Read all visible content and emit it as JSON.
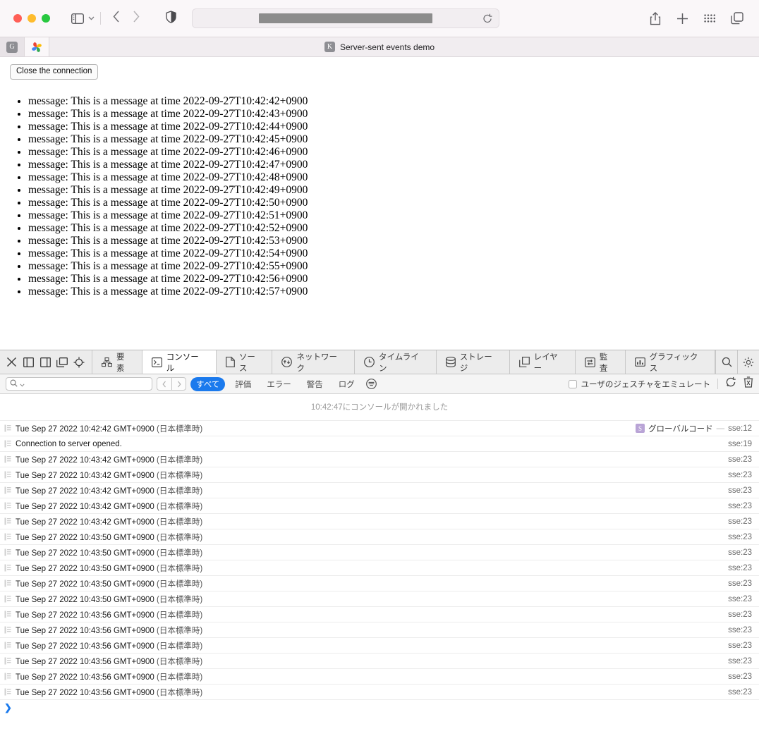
{
  "browser": {
    "window_controls": [
      "close",
      "minimize",
      "zoom"
    ],
    "sidebar_icon": "sidebar-icon",
    "dropdown_icon": "chevron-down-icon",
    "back_icon": "back-chevron-icon",
    "forward_icon": "forward-chevron-icon",
    "shield_icon": "privacy-shield-icon",
    "address_value": "",
    "address_placeholder": "",
    "reload_icon": "reload-icon",
    "share_icon": "share-icon",
    "new_tab_icon": "plus-icon",
    "apps_icon": "grid-apps-icon",
    "tab_overview_icon": "tab-overview-icon"
  },
  "tabs": {
    "items": [
      {
        "favicon_letter": "G",
        "name": "google-tab"
      },
      {
        "favicon_letter": "",
        "name": "photos-tab"
      }
    ],
    "active_title": "Server-sent events demo",
    "active_favicon_letter": "K"
  },
  "page": {
    "close_button_label": "Close the connection",
    "messages": [
      "message: This is a message at time 2022-09-27T10:42:42+0900",
      "message: This is a message at time 2022-09-27T10:42:43+0900",
      "message: This is a message at time 2022-09-27T10:42:44+0900",
      "message: This is a message at time 2022-09-27T10:42:45+0900",
      "message: This is a message at time 2022-09-27T10:42:46+0900",
      "message: This is a message at time 2022-09-27T10:42:47+0900",
      "message: This is a message at time 2022-09-27T10:42:48+0900",
      "message: This is a message at time 2022-09-27T10:42:49+0900",
      "message: This is a message at time 2022-09-27T10:42:50+0900",
      "message: This is a message at time 2022-09-27T10:42:51+0900",
      "message: This is a message at time 2022-09-27T10:42:52+0900",
      "message: This is a message at time 2022-09-27T10:42:53+0900",
      "message: This is a message at time 2022-09-27T10:42:54+0900",
      "message: This is a message at time 2022-09-27T10:42:55+0900",
      "message: This is a message at time 2022-09-27T10:42:56+0900",
      "message: This is a message at time 2022-09-27T10:42:57+0900"
    ]
  },
  "devtools": {
    "left_icons": [
      {
        "name": "close-devtools-icon"
      },
      {
        "name": "dock-left-icon"
      },
      {
        "name": "dock-right-icon"
      },
      {
        "name": "dock-undock-icon"
      },
      {
        "name": "inspect-element-icon"
      }
    ],
    "tabs": [
      {
        "label": "要素",
        "icon": "elements-icon",
        "selected": false
      },
      {
        "label": "コンソール",
        "icon": "console-icon",
        "selected": true
      },
      {
        "label": "ソース",
        "icon": "sources-icon",
        "selected": false
      },
      {
        "label": "ネットワーク",
        "icon": "network-icon",
        "selected": false
      },
      {
        "label": "タイムライン",
        "icon": "timeline-icon",
        "selected": false
      },
      {
        "label": "ストレージ",
        "icon": "storage-icon",
        "selected": false
      },
      {
        "label": "レイヤー",
        "icon": "layers-icon",
        "selected": false
      },
      {
        "label": "監査",
        "icon": "audit-icon",
        "selected": false
      },
      {
        "label": "グラフィックス",
        "icon": "graphics-icon",
        "selected": false
      }
    ],
    "right_icons": [
      {
        "name": "search-icon"
      },
      {
        "name": "gear-icon"
      }
    ],
    "filter_bar": {
      "search_value": "",
      "search_placeholder": "",
      "search_icon": "search-icon",
      "search_dropdown_icon": "chevron-down-icon",
      "prev_icon": "prev-chevron-icon",
      "next_icon": "next-chevron-icon",
      "pills": [
        {
          "label": "すべて",
          "active": true
        },
        {
          "label": "評価",
          "active": false
        },
        {
          "label": "エラー",
          "active": false
        },
        {
          "label": "警告",
          "active": false
        },
        {
          "label": "ログ",
          "active": false
        }
      ],
      "settings_icon": "filter-settings-icon",
      "emulate_gesture_label": "ユーザのジェスチャをエミュレート",
      "emulate_gesture_checked": false,
      "preserve_log_icon": "preserve-log-icon",
      "clear_console_icon": "trash-icon"
    },
    "console": {
      "opened_notice": "10:42:47にコンソールが開かれました",
      "rows": [
        {
          "icon": "log-icon",
          "message": "Tue Sep 27 2022 10:42:42 GMT+0900 ",
          "tz": "(日本標準時)",
          "badge": "S",
          "fn": "グローバルコード",
          "dash": "—",
          "link": "sse:12"
        },
        {
          "icon": "log-icon",
          "message": "Connection to server opened.",
          "tz": "",
          "badge": "",
          "fn": "",
          "dash": "",
          "link": "sse:19"
        },
        {
          "icon": "log-icon",
          "message": "Tue Sep 27 2022 10:43:42 GMT+0900 ",
          "tz": "(日本標準時)",
          "badge": "",
          "fn": "",
          "dash": "",
          "link": "sse:23"
        },
        {
          "icon": "log-icon",
          "message": "Tue Sep 27 2022 10:43:42 GMT+0900 ",
          "tz": "(日本標準時)",
          "badge": "",
          "fn": "",
          "dash": "",
          "link": "sse:23"
        },
        {
          "icon": "log-icon",
          "message": "Tue Sep 27 2022 10:43:42 GMT+0900 ",
          "tz": "(日本標準時)",
          "badge": "",
          "fn": "",
          "dash": "",
          "link": "sse:23"
        },
        {
          "icon": "log-icon",
          "message": "Tue Sep 27 2022 10:43:42 GMT+0900 ",
          "tz": "(日本標準時)",
          "badge": "",
          "fn": "",
          "dash": "",
          "link": "sse:23"
        },
        {
          "icon": "log-icon",
          "message": "Tue Sep 27 2022 10:43:42 GMT+0900 ",
          "tz": "(日本標準時)",
          "badge": "",
          "fn": "",
          "dash": "",
          "link": "sse:23"
        },
        {
          "icon": "log-icon",
          "message": "Tue Sep 27 2022 10:43:50 GMT+0900 ",
          "tz": "(日本標準時)",
          "badge": "",
          "fn": "",
          "dash": "",
          "link": "sse:23"
        },
        {
          "icon": "log-icon",
          "message": "Tue Sep 27 2022 10:43:50 GMT+0900 ",
          "tz": "(日本標準時)",
          "badge": "",
          "fn": "",
          "dash": "",
          "link": "sse:23"
        },
        {
          "icon": "log-icon",
          "message": "Tue Sep 27 2022 10:43:50 GMT+0900 ",
          "tz": "(日本標準時)",
          "badge": "",
          "fn": "",
          "dash": "",
          "link": "sse:23"
        },
        {
          "icon": "log-icon",
          "message": "Tue Sep 27 2022 10:43:50 GMT+0900 ",
          "tz": "(日本標準時)",
          "badge": "",
          "fn": "",
          "dash": "",
          "link": "sse:23"
        },
        {
          "icon": "log-icon",
          "message": "Tue Sep 27 2022 10:43:50 GMT+0900 ",
          "tz": "(日本標準時)",
          "badge": "",
          "fn": "",
          "dash": "",
          "link": "sse:23"
        },
        {
          "icon": "log-icon",
          "message": "Tue Sep 27 2022 10:43:56 GMT+0900 ",
          "tz": "(日本標準時)",
          "badge": "",
          "fn": "",
          "dash": "",
          "link": "sse:23"
        },
        {
          "icon": "log-icon",
          "message": "Tue Sep 27 2022 10:43:56 GMT+0900 ",
          "tz": "(日本標準時)",
          "badge": "",
          "fn": "",
          "dash": "",
          "link": "sse:23"
        },
        {
          "icon": "log-icon",
          "message": "Tue Sep 27 2022 10:43:56 GMT+0900 ",
          "tz": "(日本標準時)",
          "badge": "",
          "fn": "",
          "dash": "",
          "link": "sse:23"
        },
        {
          "icon": "log-icon",
          "message": "Tue Sep 27 2022 10:43:56 GMT+0900 ",
          "tz": "(日本標準時)",
          "badge": "",
          "fn": "",
          "dash": "",
          "link": "sse:23"
        },
        {
          "icon": "log-icon",
          "message": "Tue Sep 27 2022 10:43:56 GMT+0900 ",
          "tz": "(日本標準時)",
          "badge": "",
          "fn": "",
          "dash": "",
          "link": "sse:23"
        },
        {
          "icon": "log-icon",
          "message": "Tue Sep 27 2022 10:43:56 GMT+0900 ",
          "tz": "(日本標準時)",
          "badge": "",
          "fn": "",
          "dash": "",
          "link": "sse:23"
        }
      ],
      "prompt_symbol": "❯"
    }
  },
  "colors": {
    "accent_blue": "#1b7aed",
    "chrome_bg": "#faf7f9",
    "devtools_bg": "#ececec",
    "badge_purple": "#b9a4d6"
  }
}
